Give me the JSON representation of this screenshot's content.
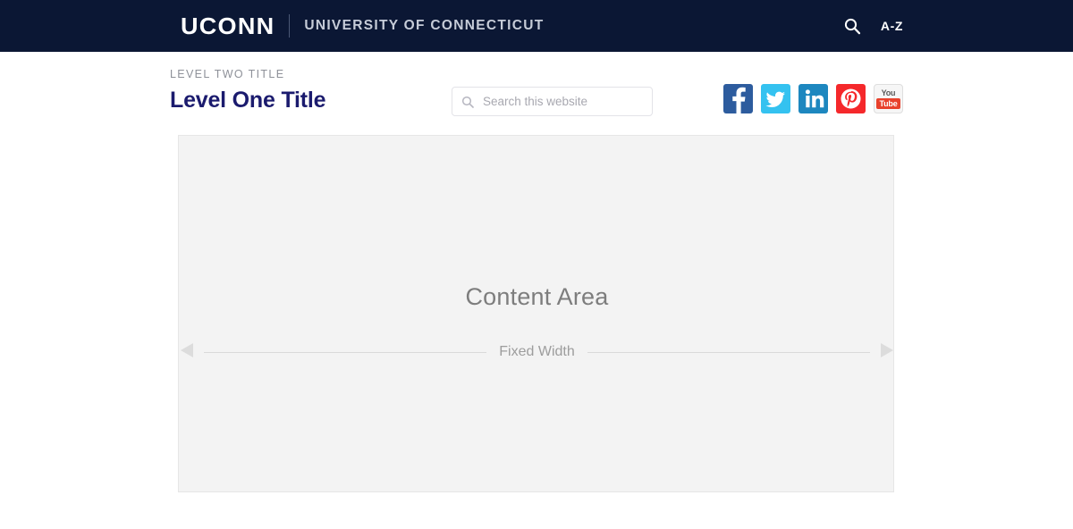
{
  "topbar": {
    "brand_mark": "UCONN",
    "brand_full": "UNIVERSITY OF CONNECTICUT",
    "search_icon": "search-icon",
    "az_label": "A-Z",
    "background_color": "#0b1734"
  },
  "header": {
    "level_two_title": "LEVEL TWO TITLE",
    "level_one_title": "Level One Title",
    "title_color": "#1b1b6e",
    "search": {
      "placeholder": "Search this website",
      "value": "",
      "icon": "search-icon"
    },
    "social": [
      {
        "name": "Facebook",
        "icon": "facebook-icon",
        "color": "#2d5c9e"
      },
      {
        "name": "Twitter",
        "icon": "twitter-icon",
        "color": "#34c2f0"
      },
      {
        "name": "LinkedIn",
        "icon": "linkedin-icon",
        "color": "#1d87bf"
      },
      {
        "name": "Pinterest",
        "icon": "pinterest-icon",
        "color": "#f5282b"
      },
      {
        "name": "YouTube",
        "icon": "youtube-icon",
        "color": "#e8412c",
        "label_top": "You",
        "label_bottom": "Tube"
      }
    ]
  },
  "content": {
    "area_label": "Content Area",
    "measure_label": "Fixed Width",
    "background_color": "#f3f3f3",
    "border_color": "#e6e6e6"
  }
}
